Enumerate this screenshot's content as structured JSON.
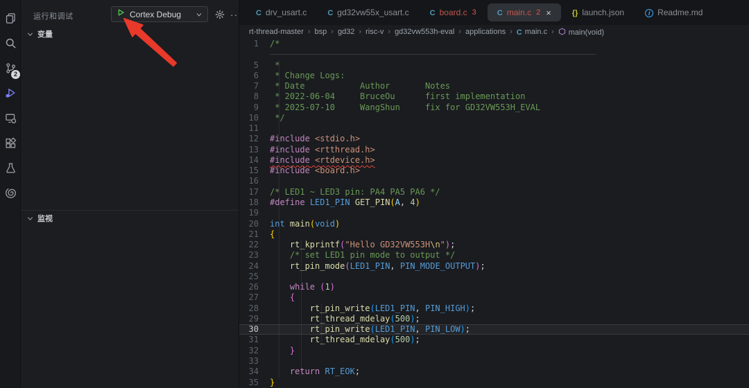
{
  "colors": {
    "arrow_red": "#e8392b",
    "error_red": "#e5534b",
    "run_green": "#4fc14f",
    "file_icon_blue": "#519aba",
    "json_icon_yellow": "#c5c531",
    "symbol_purple": "#b180d7"
  },
  "activity_bar": {
    "icons": [
      {
        "name": "files",
        "active": false
      },
      {
        "name": "search",
        "active": false
      },
      {
        "name": "source-control",
        "active": false,
        "badge": "2"
      },
      {
        "name": "debug",
        "active": true
      },
      {
        "name": "remote",
        "active": false
      },
      {
        "name": "extensions",
        "active": false
      },
      {
        "name": "beaker",
        "active": false
      },
      {
        "name": "spiral",
        "active": false
      }
    ]
  },
  "sidebar": {
    "title": "运行和调试",
    "debug_config": "Cortex Debug",
    "sections": [
      {
        "label": "变量"
      },
      {
        "label": "监视"
      }
    ]
  },
  "tabs": [
    {
      "label": "drv_usart.c",
      "icon": "c",
      "active": false,
      "error": false,
      "count": "",
      "close": false
    },
    {
      "label": "gd32vw55x_usart.c",
      "icon": "c",
      "active": false,
      "error": false,
      "count": "",
      "close": false
    },
    {
      "label": "board.c",
      "icon": "c",
      "active": false,
      "error": true,
      "count": "3",
      "close": false
    },
    {
      "label": "main.c",
      "icon": "c",
      "active": true,
      "error": true,
      "count": "2",
      "close": true
    },
    {
      "label": "launch.json",
      "icon": "braces",
      "active": false,
      "error": false,
      "count": "",
      "close": false
    },
    {
      "label": "Readme.md",
      "icon": "info",
      "active": false,
      "error": false,
      "count": "",
      "close": false
    }
  ],
  "breadcrumb": {
    "path": [
      "rt-thread-master",
      "bsp",
      "gd32",
      "risc-v",
      "gd32vw553h-eval",
      "applications"
    ],
    "file": "main.c",
    "symbol": "main(void)"
  },
  "editor": {
    "lines": [
      {
        "n": "1",
        "segs": [
          [
            "cm",
            "/*"
          ]
        ]
      },
      {
        "n": "",
        "ghost": true,
        "segs": []
      },
      {
        "n": "5",
        "segs": [
          [
            "cm",
            " *"
          ]
        ]
      },
      {
        "n": "6",
        "segs": [
          [
            "cm",
            " * Change Logs:"
          ]
        ]
      },
      {
        "n": "7",
        "segs": [
          [
            "cm",
            " * Date           Author       Notes"
          ]
        ]
      },
      {
        "n": "8",
        "segs": [
          [
            "cm",
            " * 2022-06-04     BruceOu      first implementation"
          ]
        ]
      },
      {
        "n": "9",
        "segs": [
          [
            "cm",
            " * 2025-07-10     WangShun     fix for GD32VW553H_EVAL"
          ]
        ]
      },
      {
        "n": "10",
        "segs": [
          [
            "cm",
            " */"
          ]
        ]
      },
      {
        "n": "11",
        "segs": []
      },
      {
        "n": "12",
        "segs": [
          [
            "pp",
            "#include"
          ],
          [
            "tx",
            " "
          ],
          [
            "str",
            "<stdio.h>"
          ]
        ]
      },
      {
        "n": "13",
        "segs": [
          [
            "pp",
            "#include"
          ],
          [
            "tx",
            " "
          ],
          [
            "str",
            "<rtthread.h>"
          ]
        ]
      },
      {
        "n": "14",
        "squiggle": true,
        "segs": [
          [
            "pp",
            "#include"
          ],
          [
            "tx",
            " "
          ],
          [
            "str",
            "<rtdevice.h>"
          ]
        ]
      },
      {
        "n": "15",
        "segs": [
          [
            "pp",
            "#include"
          ],
          [
            "tx",
            " "
          ],
          [
            "str",
            "<board.h>"
          ]
        ]
      },
      {
        "n": "16",
        "segs": []
      },
      {
        "n": "17",
        "segs": [
          [
            "cm",
            "/* LED1 ~ LED3 pin: PA4 PA5 PA6 */"
          ]
        ]
      },
      {
        "n": "18",
        "segs": [
          [
            "pp",
            "#define"
          ],
          [
            "tx",
            " "
          ],
          [
            "kw",
            "LED1_PIN"
          ],
          [
            "tx",
            " "
          ],
          [
            "fn",
            "GET_PIN"
          ],
          [
            "b1",
            "("
          ],
          [
            "vr",
            "A"
          ],
          [
            "tx",
            ", "
          ],
          [
            "num",
            "4"
          ],
          [
            "b1",
            ")"
          ]
        ]
      },
      {
        "n": "19",
        "segs": []
      },
      {
        "n": "20",
        "segs": [
          [
            "kw",
            "int"
          ],
          [
            "tx",
            " "
          ],
          [
            "fn",
            "main"
          ],
          [
            "b1",
            "("
          ],
          [
            "kw",
            "void"
          ],
          [
            "b1",
            ")"
          ]
        ]
      },
      {
        "n": "21",
        "segs": [
          [
            "b1",
            "{"
          ]
        ]
      },
      {
        "n": "22",
        "segs": [
          [
            "tx",
            "    "
          ],
          [
            "fn",
            "rt_kprintf"
          ],
          [
            "b2",
            "("
          ],
          [
            "str",
            "\"Hello GD32VW553H"
          ],
          [
            "esc",
            "\\n"
          ],
          [
            "str",
            "\""
          ],
          [
            "b2",
            ")"
          ],
          [
            "tx",
            ";"
          ]
        ]
      },
      {
        "n": "23",
        "segs": [
          [
            "tx",
            "    "
          ],
          [
            "cm",
            "/* set LED1 pin mode to output */"
          ]
        ]
      },
      {
        "n": "24",
        "segs": [
          [
            "tx",
            "    "
          ],
          [
            "fn",
            "rt_pin_mode"
          ],
          [
            "b2",
            "("
          ],
          [
            "kw",
            "LED1_PIN"
          ],
          [
            "tx",
            ", "
          ],
          [
            "kw",
            "PIN_MODE_OUTPUT"
          ],
          [
            "b2",
            ")"
          ],
          [
            "tx",
            ";"
          ]
        ]
      },
      {
        "n": "25",
        "segs": []
      },
      {
        "n": "26",
        "segs": [
          [
            "tx",
            "    "
          ],
          [
            "pp",
            "while"
          ],
          [
            "tx",
            " "
          ],
          [
            "b2",
            "("
          ],
          [
            "num",
            "1"
          ],
          [
            "b2",
            ")"
          ]
        ]
      },
      {
        "n": "27",
        "segs": [
          [
            "tx",
            "    "
          ],
          [
            "b2",
            "{"
          ]
        ]
      },
      {
        "n": "28",
        "segs": [
          [
            "tx",
            "        "
          ],
          [
            "fn",
            "rt_pin_write"
          ],
          [
            "b3",
            "("
          ],
          [
            "kw",
            "LED1_PIN"
          ],
          [
            "tx",
            ", "
          ],
          [
            "kw",
            "PIN_HIGH"
          ],
          [
            "b3",
            ")"
          ],
          [
            "tx",
            ";"
          ]
        ]
      },
      {
        "n": "29",
        "segs": [
          [
            "tx",
            "        "
          ],
          [
            "fn",
            "rt_thread_mdelay"
          ],
          [
            "b3",
            "("
          ],
          [
            "num",
            "500"
          ],
          [
            "b3",
            ")"
          ],
          [
            "tx",
            ";"
          ]
        ]
      },
      {
        "n": "30",
        "current": true,
        "segs": [
          [
            "tx",
            "        "
          ],
          [
            "fn",
            "rt_pin_write"
          ],
          [
            "b3",
            "("
          ],
          [
            "kw",
            "LED1_PIN"
          ],
          [
            "tx",
            ", "
          ],
          [
            "kw",
            "PIN_LOW"
          ],
          [
            "b3",
            ")"
          ],
          [
            "tx",
            ";"
          ]
        ]
      },
      {
        "n": "31",
        "segs": [
          [
            "tx",
            "        "
          ],
          [
            "fn",
            "rt_thread_mdelay"
          ],
          [
            "b3",
            "("
          ],
          [
            "num",
            "500"
          ],
          [
            "b3",
            ")"
          ],
          [
            "tx",
            ";"
          ]
        ]
      },
      {
        "n": "32",
        "segs": [
          [
            "tx",
            "    "
          ],
          [
            "b2",
            "}"
          ]
        ]
      },
      {
        "n": "33",
        "segs": []
      },
      {
        "n": "34",
        "segs": [
          [
            "tx",
            "    "
          ],
          [
            "pp",
            "return"
          ],
          [
            "tx",
            " "
          ],
          [
            "kw",
            "RT_EOK"
          ],
          [
            "tx",
            ";"
          ]
        ]
      },
      {
        "n": "35",
        "segs": [
          [
            "b1",
            "}"
          ]
        ]
      }
    ]
  }
}
